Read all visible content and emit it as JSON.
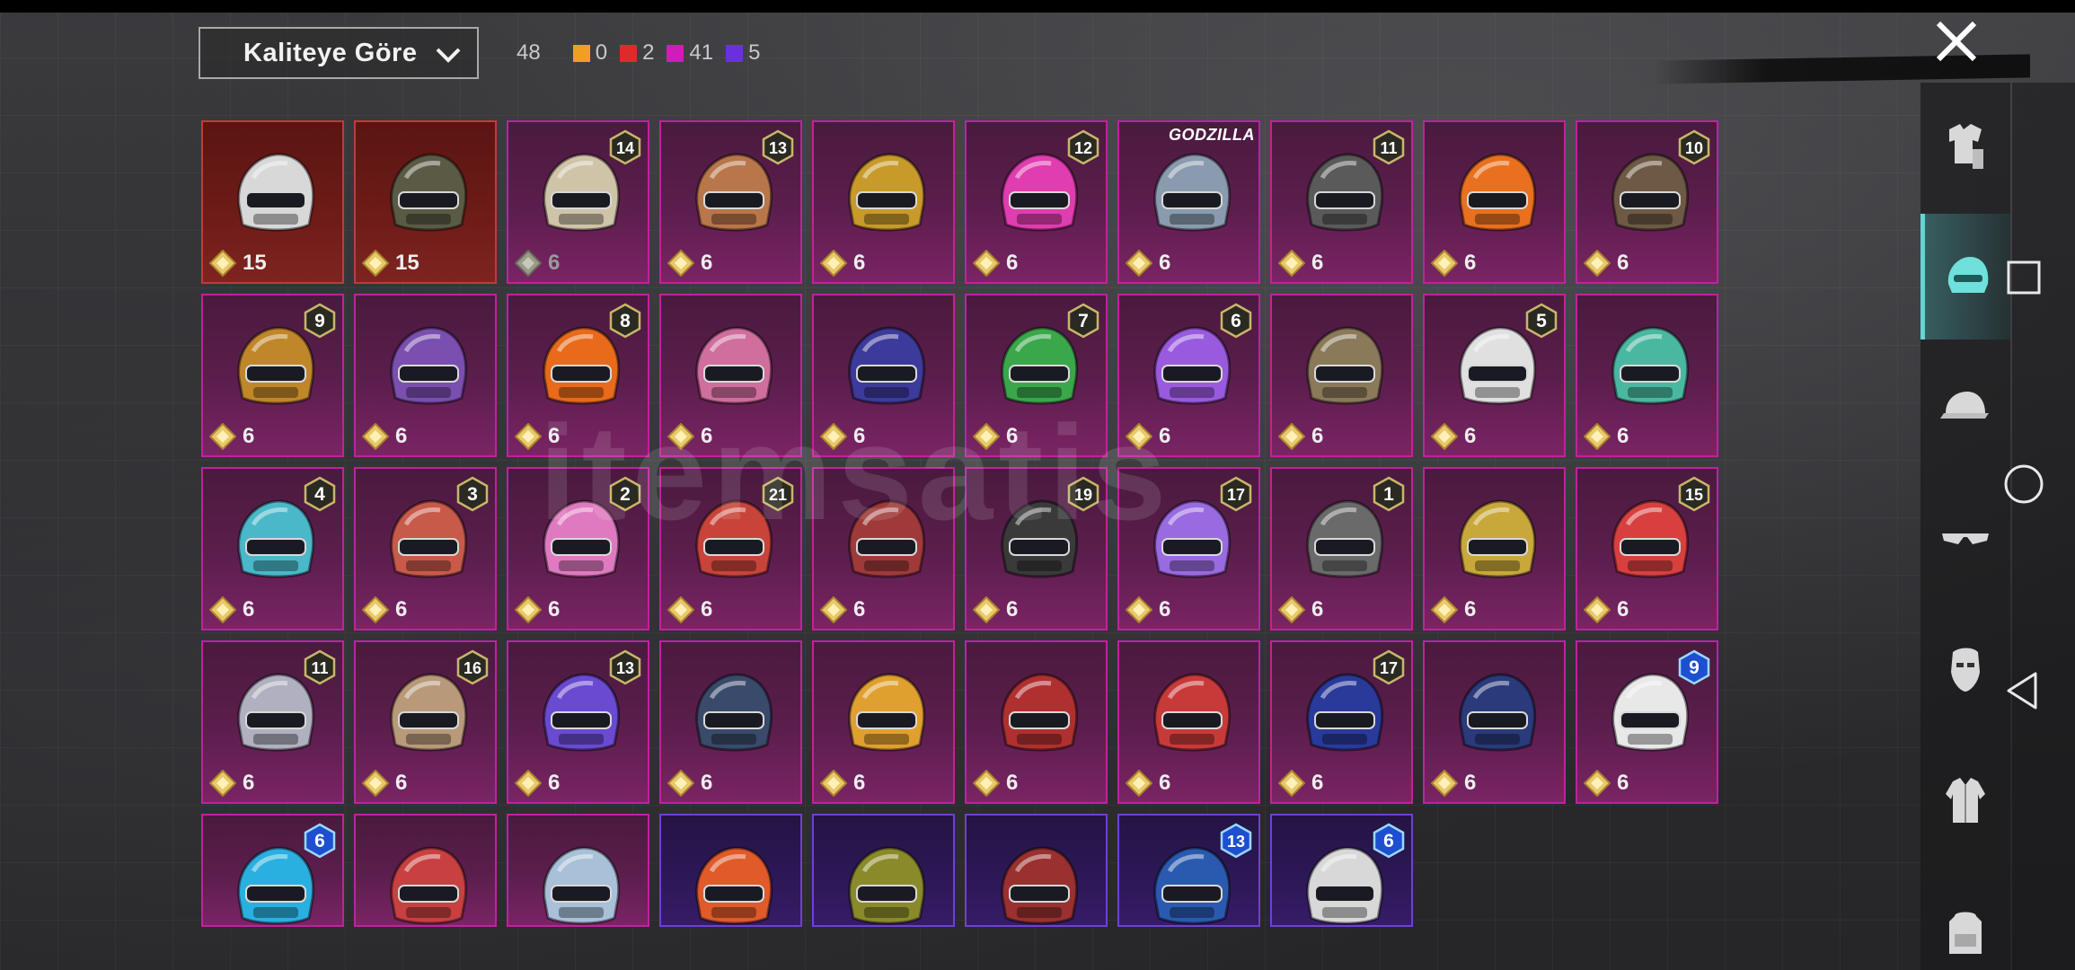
{
  "header": {
    "sort_label": "Kaliteye Göre",
    "total_count": "48",
    "counts": [
      {
        "value": "0",
        "color": "#f0a020"
      },
      {
        "value": "2",
        "color": "#e02a2a"
      },
      {
        "value": "41",
        "color": "#d01cb8"
      },
      {
        "value": "5",
        "color": "#6a30e0"
      }
    ]
  },
  "watermark": "itemsatis",
  "sidebar": {
    "items": [
      {
        "icon": "outfit-icon"
      },
      {
        "icon": "helmet-icon",
        "active": true
      },
      {
        "icon": "cap-icon"
      },
      {
        "icon": "glasses-icon"
      },
      {
        "icon": "mask-icon"
      },
      {
        "icon": "jacket-icon"
      },
      {
        "icon": "backpack-icon"
      }
    ]
  },
  "items": [
    {
      "rarity": "red",
      "value": "15",
      "level": "",
      "color": "#d8d8d8"
    },
    {
      "rarity": "red",
      "value": "15",
      "level": "",
      "color": "#5b5b45"
    },
    {
      "rarity": "pink",
      "value": "6",
      "level": "14",
      "color": "#cfc3a8"
    },
    {
      "rarity": "pink",
      "value": "6",
      "level": "13",
      "color": "#b8764a"
    },
    {
      "rarity": "pink",
      "value": "6",
      "level": "",
      "color": "#c79a2a"
    },
    {
      "rarity": "pink",
      "value": "6",
      "level": "12",
      "color": "#e03db0"
    },
    {
      "rarity": "pink",
      "value": "6",
      "level": "",
      "color": "#8a9bb0",
      "tag": "GODZILLA"
    },
    {
      "rarity": "pink",
      "value": "6",
      "level": "11",
      "color": "#5a5a5a"
    },
    {
      "rarity": "pink",
      "value": "6",
      "level": "",
      "color": "#e8701e"
    },
    {
      "rarity": "pink",
      "value": "6",
      "level": "10",
      "color": "#6e5a44"
    },
    {
      "rarity": "pink",
      "value": "6",
      "level": "9",
      "color": "#c0872a"
    },
    {
      "rarity": "pink",
      "value": "6",
      "level": "",
      "color": "#7a4fb0"
    },
    {
      "rarity": "pink",
      "value": "6",
      "level": "8",
      "color": "#e86a1a"
    },
    {
      "rarity": "pink",
      "value": "6",
      "level": "",
      "color": "#d06e9e"
    },
    {
      "rarity": "pink",
      "value": "6",
      "level": "",
      "color": "#3c3a9a"
    },
    {
      "rarity": "pink",
      "value": "6",
      "level": "7",
      "color": "#3aa84a"
    },
    {
      "rarity": "pink",
      "value": "6",
      "level": "6",
      "color": "#9a5ae0"
    },
    {
      "rarity": "pink",
      "value": "6",
      "level": "",
      "color": "#8a7a5a"
    },
    {
      "rarity": "pink",
      "value": "6",
      "level": "5",
      "color": "#e0e0e0"
    },
    {
      "rarity": "pink",
      "value": "6",
      "level": "",
      "color": "#4ab8a0"
    },
    {
      "rarity": "pink",
      "value": "6",
      "level": "4",
      "color": "#4ab8c8"
    },
    {
      "rarity": "pink",
      "value": "6",
      "level": "3",
      "color": "#c85a4a"
    },
    {
      "rarity": "pink",
      "value": "6",
      "level": "2",
      "color": "#e07ac0"
    },
    {
      "rarity": "pink",
      "value": "6",
      "level": "21",
      "color": "#c8443a"
    },
    {
      "rarity": "pink",
      "value": "6",
      "level": "",
      "color": "#a03a3a"
    },
    {
      "rarity": "pink",
      "value": "6",
      "level": "19",
      "color": "#3a3a3a"
    },
    {
      "rarity": "pink",
      "value": "6",
      "level": "17",
      "color": "#9a6ae0"
    },
    {
      "rarity": "pink",
      "value": "6",
      "level": "1",
      "color": "#6a6a6a"
    },
    {
      "rarity": "pink",
      "value": "6",
      "level": "",
      "color": "#c8a83a"
    },
    {
      "rarity": "pink",
      "value": "6",
      "level": "15",
      "color": "#d84040"
    },
    {
      "rarity": "pink",
      "value": "6",
      "level": "11",
      "color": "#b0b0c0"
    },
    {
      "rarity": "pink",
      "value": "6",
      "level": "16",
      "color": "#b89a7a"
    },
    {
      "rarity": "pink",
      "value": "6",
      "level": "13",
      "color": "#6a4ad0"
    },
    {
      "rarity": "pink",
      "value": "6",
      "level": "",
      "color": "#3a4a6a"
    },
    {
      "rarity": "pink",
      "value": "6",
      "level": "",
      "color": "#e0a030"
    },
    {
      "rarity": "pink",
      "value": "6",
      "level": "",
      "color": "#b03030"
    },
    {
      "rarity": "pink",
      "value": "6",
      "level": "",
      "color": "#c83a3a"
    },
    {
      "rarity": "pink",
      "value": "6",
      "level": "17",
      "color": "#2a3a9a"
    },
    {
      "rarity": "pink",
      "value": "6",
      "level": "",
      "color": "#2a3a7a"
    },
    {
      "rarity": "pink",
      "value": "6",
      "level": "9",
      "color": "#e8e8e8"
    },
    {
      "rarity": "pink",
      "value": "",
      "level": "6",
      "color": "#2ab0e0"
    },
    {
      "rarity": "pink",
      "value": "",
      "level": "",
      "color": "#c84040"
    },
    {
      "rarity": "pink",
      "value": "",
      "level": "",
      "color": "#a8c0d8"
    },
    {
      "rarity": "purple",
      "value": "",
      "level": "",
      "color": "#e05a2a"
    },
    {
      "rarity": "purple",
      "value": "",
      "level": "",
      "color": "#8a8a2a"
    },
    {
      "rarity": "purple",
      "value": "",
      "level": "",
      "color": "#9a3030"
    },
    {
      "rarity": "purple",
      "value": "",
      "level": "13",
      "color": "#2a5ab0"
    },
    {
      "rarity": "purple",
      "value": "",
      "level": "6",
      "color": "#d8d8d8"
    }
  ]
}
